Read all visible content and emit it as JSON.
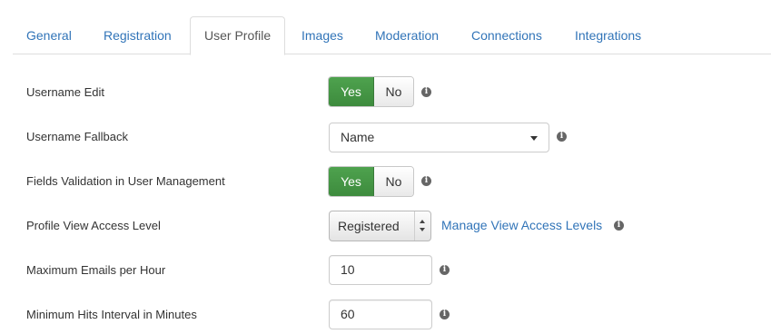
{
  "tabs": [
    {
      "label": "General"
    },
    {
      "label": "Registration"
    },
    {
      "label": "User Profile"
    },
    {
      "label": "Images"
    },
    {
      "label": "Moderation"
    },
    {
      "label": "Connections"
    },
    {
      "label": "Integrations"
    }
  ],
  "active_tab": "User Profile",
  "fields": {
    "username_edit": {
      "label": "Username Edit",
      "yes": "Yes",
      "no": "No",
      "selected": "Yes"
    },
    "username_fallback": {
      "label": "Username Fallback",
      "value": "Name"
    },
    "fields_validation": {
      "label": "Fields Validation in User Management",
      "yes": "Yes",
      "no": "No",
      "selected": "Yes"
    },
    "profile_view_access": {
      "label": "Profile View Access Level",
      "value": "Registered",
      "link": "Manage View Access Levels"
    },
    "max_emails": {
      "label": "Maximum Emails per Hour",
      "value": "10"
    },
    "min_hits": {
      "label": "Minimum Hits Interval in Minutes",
      "value": "60"
    }
  },
  "icons": {
    "info": "info-icon",
    "glyph": "i"
  },
  "colors": {
    "link": "#3174b8",
    "yes_active": "#4ea24e",
    "tab_border": "#dddddd"
  }
}
